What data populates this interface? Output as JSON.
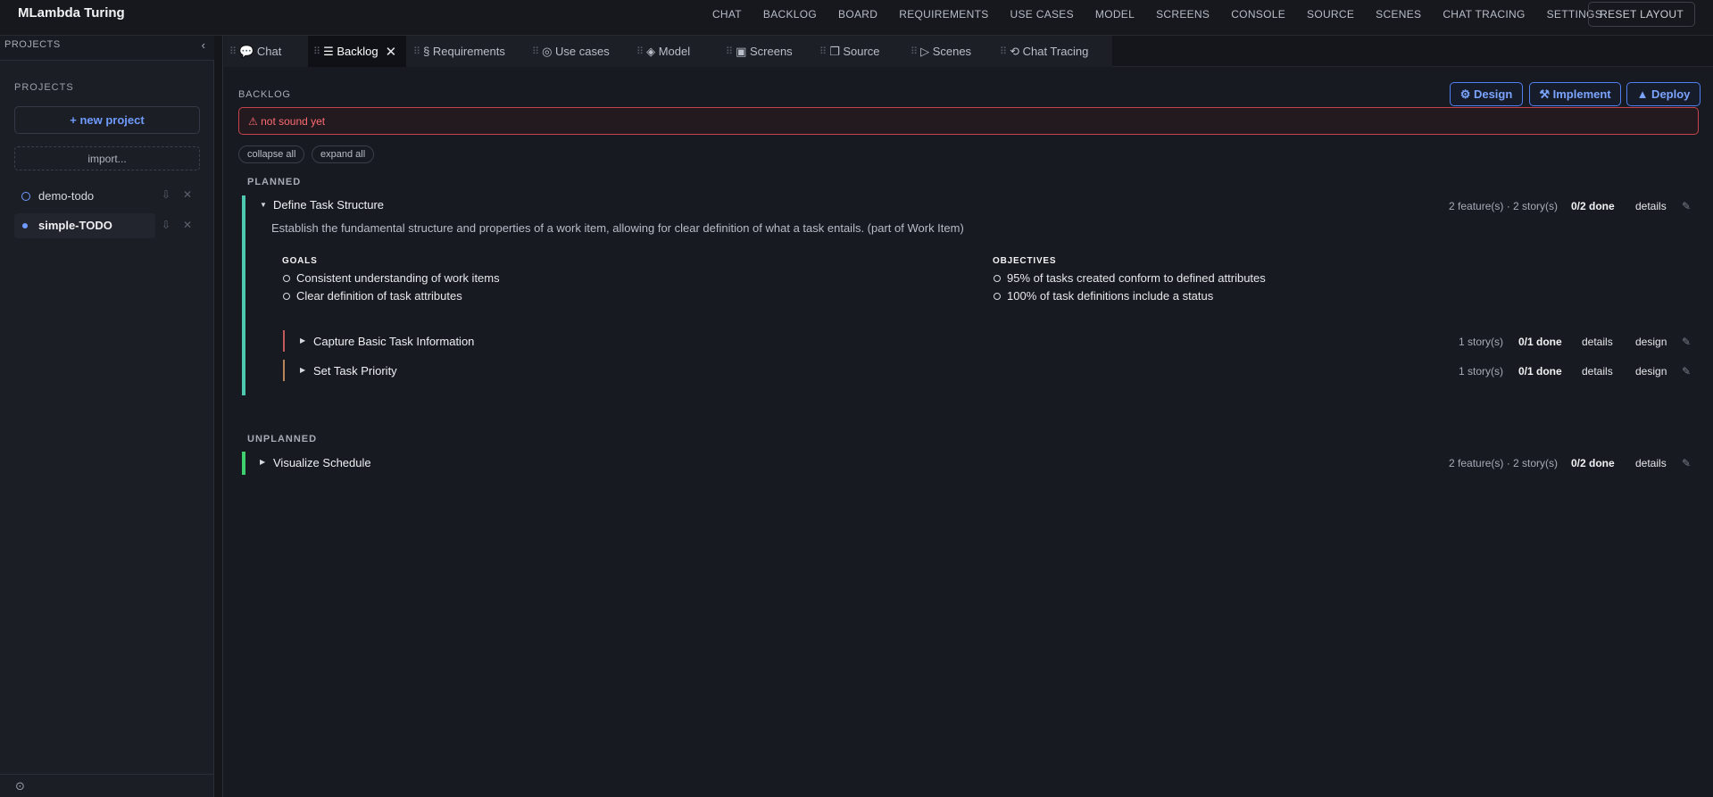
{
  "app": {
    "title": "MLambda Turing"
  },
  "topnav": [
    "CHAT",
    "BACKLOG",
    "BOARD",
    "REQUIREMENTS",
    "USE CASES",
    "MODEL",
    "SCREENS",
    "CONSOLE",
    "SOURCE",
    "SCENES",
    "CHAT TRACING",
    "SETTINGS"
  ],
  "reset_layout": "RESET LAYOUT",
  "sidebar": {
    "header": "PROJECTS",
    "section": "PROJECTS",
    "new_project": "+ new project",
    "import": "import...",
    "projects": [
      {
        "name": "demo-todo",
        "active": false
      },
      {
        "name": "simple-TODO",
        "active": true
      }
    ]
  },
  "tabs": [
    {
      "label": "Chat",
      "icon": "💬"
    },
    {
      "label": "Backlog",
      "icon": "☰",
      "active": true
    },
    {
      "label": "Requirements",
      "icon": "§"
    },
    {
      "label": "Use cases",
      "icon": "◎"
    },
    {
      "label": "Model",
      "icon": "◈"
    },
    {
      "label": "Screens",
      "icon": "▣"
    },
    {
      "label": "Source",
      "icon": "❐"
    },
    {
      "label": "Scenes",
      "icon": "▷"
    },
    {
      "label": "Chat Tracing",
      "icon": "⟲"
    }
  ],
  "backlog": {
    "title": "BACKLOG",
    "actions": {
      "design": "⚙ Design",
      "implement": "⚒ Implement",
      "deploy": "▲ Deploy"
    },
    "warning": "⚠ not sound yet",
    "collapse_all": "collapse all",
    "expand_all": "expand all",
    "planned_label": "PLANNED",
    "unplanned_label": "UNPLANNED",
    "planned": {
      "title": "Define Task Structure",
      "meta": "2 feature(s) · 2 story(s)",
      "done": "0/2 done",
      "details": "details",
      "description": "Establish the fundamental structure and properties of a work item, allowing for clear definition of what a task entails. (part of Work Item)",
      "goals_label": "GOALS",
      "goals": [
        "Consistent understanding of work items",
        "Clear definition of task attributes"
      ],
      "objectives_label": "OBJECTIVES",
      "objectives": [
        "95% of tasks created conform to defined attributes",
        "100% of task definitions include a status"
      ],
      "features": [
        {
          "title": "Capture Basic Task Information",
          "meta": "1 story(s)",
          "done": "0/1 done",
          "details": "details",
          "design": "design"
        },
        {
          "title": "Set Task Priority",
          "meta": "1 story(s)",
          "done": "0/1 done",
          "details": "details",
          "design": "design"
        }
      ]
    },
    "unplanned": {
      "title": "Visualize Schedule",
      "meta": "2 feature(s) · 2 story(s)",
      "done": "0/2 done",
      "details": "details"
    }
  },
  "colors": {
    "accent": "#6f9bff",
    "epic_bar_planned": "#4ec9b0",
    "epic_bar_unplanned": "#3ecf6e",
    "feature_bar_1": "#c25a5a",
    "feature_bar_2": "#b8845a",
    "warning": "#ff6a72"
  }
}
